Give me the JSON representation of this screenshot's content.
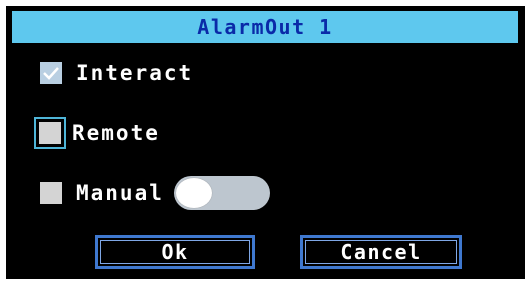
{
  "dialog": {
    "title": "AlarmOut 1"
  },
  "options": [
    {
      "label": "Interact",
      "checked": true
    },
    {
      "label": "Remote",
      "checked": false,
      "focused": true
    },
    {
      "label": "Manual",
      "checked": false
    }
  ],
  "manual_toggle": {
    "on": false
  },
  "buttons": {
    "ok": "Ok",
    "cancel": "Cancel"
  },
  "colors": {
    "title_bar": "#5ec8ee",
    "title_text": "#0a2aa8",
    "background": "#000000",
    "button_border": "#3f78cf",
    "focus_ring": "#4fb5d8"
  }
}
